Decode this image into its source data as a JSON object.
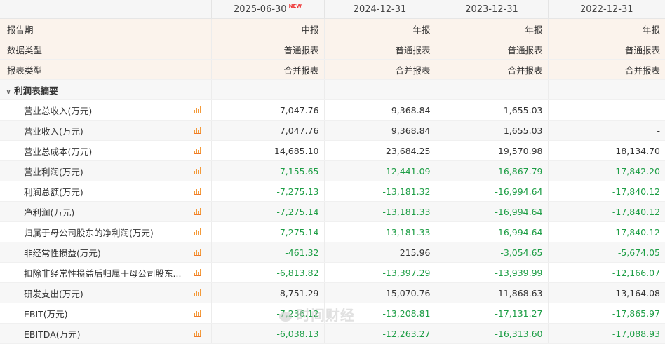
{
  "header": {
    "dates": [
      "2025-06-30",
      "2024-12-31",
      "2023-12-31",
      "2022-12-31"
    ],
    "new_badge": "NEW"
  },
  "meta_rows": [
    {
      "label": "报告期",
      "values": [
        "中报",
        "年报",
        "年报",
        "年报"
      ]
    },
    {
      "label": "数据类型",
      "values": [
        "普通报表",
        "普通报表",
        "普通报表",
        "普通报表"
      ]
    },
    {
      "label": "报表类型",
      "values": [
        "合并报表",
        "合并报表",
        "合并报表",
        "合并报表"
      ]
    }
  ],
  "section": {
    "label": "利润表摘要",
    "chevron": "chevron-down-icon"
  },
  "rows": [
    {
      "label": "营业总收入(万元)",
      "values": [
        "7,047.76",
        "9,368.84",
        "1,655.03",
        "-"
      ]
    },
    {
      "label": "营业收入(万元)",
      "values": [
        "7,047.76",
        "9,368.84",
        "1,655.03",
        "-"
      ]
    },
    {
      "label": "营业总成本(万元)",
      "values": [
        "14,685.10",
        "23,684.25",
        "19,570.98",
        "18,134.70"
      ]
    },
    {
      "label": "营业利润(万元)",
      "values": [
        "-7,155.65",
        "-12,441.09",
        "-16,867.79",
        "-17,842.20"
      ]
    },
    {
      "label": "利润总额(万元)",
      "values": [
        "-7,275.13",
        "-13,181.32",
        "-16,994.64",
        "-17,840.12"
      ]
    },
    {
      "label": "净利润(万元)",
      "values": [
        "-7,275.14",
        "-13,181.33",
        "-16,994.64",
        "-17,840.12"
      ]
    },
    {
      "label": "归属于母公司股东的净利润(万元)",
      "values": [
        "-7,275.14",
        "-13,181.33",
        "-16,994.64",
        "-17,840.12"
      ]
    },
    {
      "label": "非经常性损益(万元)",
      "values": [
        "-461.32",
        "215.96",
        "-3,054.65",
        "-5,674.05"
      ]
    },
    {
      "label": "扣除非经常性损益后归属于母公司股东...",
      "values": [
        "-6,813.82",
        "-13,397.29",
        "-13,939.99",
        "-12,166.07"
      ]
    },
    {
      "label": "研发支出(万元)",
      "values": [
        "8,751.29",
        "15,070.76",
        "11,868.63",
        "13,164.08"
      ]
    },
    {
      "label": "EBIT(万元)",
      "values": [
        "-7,236.12",
        "-13,208.81",
        "-17,131.27",
        "-17,865.97"
      ]
    },
    {
      "label": "EBITDA(万元)",
      "values": [
        "-6,038.13",
        "-12,263.27",
        "-16,313.60",
        "-17,088.93"
      ]
    }
  ],
  "watermark": "时间财经",
  "colors": {
    "negative": "#1e9e46",
    "positive": "#333333",
    "meta_bg": "#fbf3ec",
    "icon": "#f39a3a",
    "new_badge": "#ee3333"
  }
}
